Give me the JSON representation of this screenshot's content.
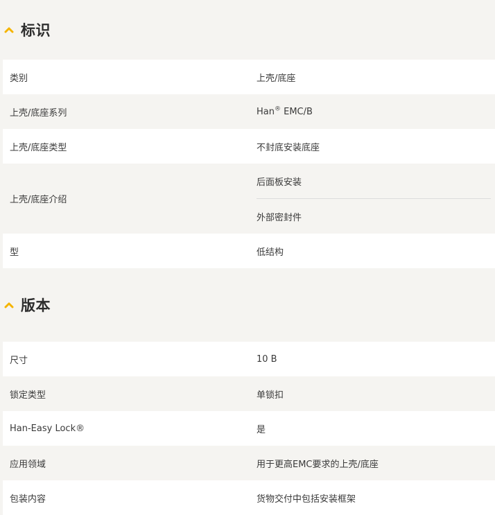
{
  "sections": [
    {
      "title": "标识",
      "icon": "chevron-up-icon",
      "rows": [
        {
          "label": "类别",
          "value": "上壳/底座"
        },
        {
          "label": "上壳/底座系列",
          "value_main": "Han",
          "value_sup": "®",
          "value_rest": " EMC/B"
        },
        {
          "label": "上壳/底座类型",
          "value": "不封底安装底座"
        },
        {
          "label": "上壳/底座介绍",
          "values": [
            "后面板安装",
            "外部密封件"
          ]
        },
        {
          "label": "型",
          "value": "低结构"
        }
      ]
    },
    {
      "title": "版本",
      "icon": "chevron-up-icon",
      "rows": [
        {
          "label": "尺寸",
          "value": "10 B"
        },
        {
          "label": "锁定类型",
          "value": "单锁扣"
        },
        {
          "label": "Han-Easy Lock®",
          "value": "是"
        },
        {
          "label": "应用领域",
          "value": "用于更高EMC要求的上壳/底座"
        },
        {
          "label": "包装内容",
          "value": "货物交付中包括安装框架"
        }
      ]
    }
  ],
  "colors": {
    "accent": "#f5b400",
    "background": "#f5f4f1",
    "row_white": "#ffffff",
    "text": "#333333"
  }
}
